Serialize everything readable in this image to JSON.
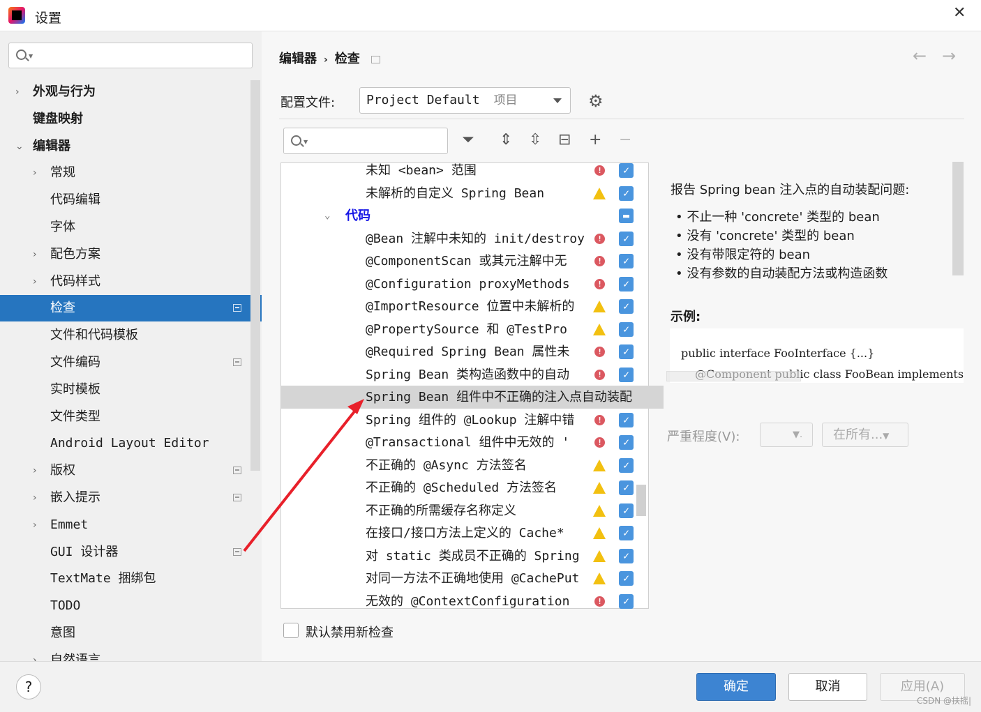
{
  "window": {
    "title": "设置",
    "close": "✕"
  },
  "sidebar": {
    "items": [
      {
        "label": "外观与行为",
        "level": 0,
        "chevron": "right"
      },
      {
        "label": "键盘映射",
        "level": 0,
        "chevron": ""
      },
      {
        "label": "编辑器",
        "level": 0,
        "chevron": "down"
      },
      {
        "label": "常规",
        "level": 1,
        "chevron": "right"
      },
      {
        "label": "代码编辑",
        "level": 1,
        "chevron": ""
      },
      {
        "label": "字体",
        "level": 1,
        "chevron": ""
      },
      {
        "label": "配色方案",
        "level": 1,
        "chevron": "right"
      },
      {
        "label": "代码样式",
        "level": 1,
        "chevron": "right"
      },
      {
        "label": "检查",
        "level": 1,
        "chevron": "",
        "selected": true,
        "project": true
      },
      {
        "label": "文件和代码模板",
        "level": 1,
        "chevron": ""
      },
      {
        "label": "文件编码",
        "level": 1,
        "chevron": "",
        "project": true
      },
      {
        "label": "实时模板",
        "level": 1,
        "chevron": ""
      },
      {
        "label": "文件类型",
        "level": 1,
        "chevron": ""
      },
      {
        "label": "Android Layout Editor",
        "level": 1,
        "chevron": ""
      },
      {
        "label": "版权",
        "level": 1,
        "chevron": "right",
        "project": true
      },
      {
        "label": "嵌入提示",
        "level": 1,
        "chevron": "right",
        "project": true
      },
      {
        "label": "Emmet",
        "level": 1,
        "chevron": "right"
      },
      {
        "label": "GUI 设计器",
        "level": 1,
        "chevron": "",
        "project": true
      },
      {
        "label": "TextMate 捆绑包",
        "level": 1,
        "chevron": ""
      },
      {
        "label": "TODO",
        "level": 1,
        "chevron": ""
      },
      {
        "label": "意图",
        "level": 1,
        "chevron": ""
      },
      {
        "label": "自然语言",
        "level": 1,
        "chevron": "right"
      }
    ]
  },
  "header": {
    "breadcrumb": [
      "编辑器",
      "›",
      "检查"
    ],
    "back": "←",
    "forward": "→"
  },
  "profile": {
    "label": "配置文件:",
    "value": "Project Default",
    "scope": "项目"
  },
  "toolbar": {
    "filter": "⏷",
    "expand": "⇕",
    "collapse": "⇳",
    "reset": "⊟",
    "add": "+",
    "remove": "−"
  },
  "inspections": [
    {
      "text": "未知 <bean> 范围",
      "severity": "error",
      "checked": true
    },
    {
      "text": "未解析的自定义 Spring Bean",
      "severity": "warning",
      "checked": true
    },
    {
      "text": "代码",
      "group": true,
      "checked": "partial"
    },
    {
      "text": "@Bean 注解中未知的 init/destroy",
      "severity": "error",
      "checked": true
    },
    {
      "text": "@ComponentScan 或其元注解中无",
      "severity": "error",
      "checked": true
    },
    {
      "text": "@Configuration proxyMethods",
      "severity": "error",
      "checked": true
    },
    {
      "text": "@ImportResource 位置中未解析的",
      "severity": "warning",
      "checked": true
    },
    {
      "text": "@PropertySource 和 @TestPro",
      "severity": "warning",
      "checked": true
    },
    {
      "text": "@Required Spring Bean 属性未",
      "severity": "error",
      "checked": true
    },
    {
      "text": "Spring Bean 类构造函数中的自动",
      "severity": "error",
      "checked": true
    },
    {
      "text": "Spring Bean 组件中不正确的注入点自动装配",
      "selected": true
    },
    {
      "text": "Spring 组件的 @Lookup 注解中错",
      "severity": "error",
      "checked": true
    },
    {
      "text": "@Transactional 组件中无效的 '",
      "severity": "error",
      "checked": true
    },
    {
      "text": "不正确的 @Async 方法签名",
      "severity": "warning",
      "checked": true
    },
    {
      "text": "不正确的 @Scheduled 方法签名",
      "severity": "warning",
      "checked": true
    },
    {
      "text": "不正确的所需缓存名称定义",
      "severity": "warning",
      "checked": true
    },
    {
      "text": "在接口/接口方法上定义的 Cache*",
      "severity": "warning",
      "checked": true
    },
    {
      "text": "对 static 类成员不正确的 Spring",
      "severity": "warning",
      "checked": true
    },
    {
      "text": "对同一方法不正确地使用 @CachePut",
      "severity": "warning",
      "checked": true
    },
    {
      "text": "无效的 @ContextConfiguration",
      "severity": "error",
      "checked": true
    }
  ],
  "description": {
    "intro": "报告 Spring bean 注入点的自动装配问题:",
    "bullets": [
      "不止一种 'concrete' 类型的 bean",
      "没有 'concrete' 类型的 bean",
      "没有带限定符的 bean",
      "没有参数的自动装配方法或构造函数"
    ],
    "example_label": "示例:",
    "code": [
      "public interface FooInterface {...}",
      "@Component public class FooBean implements"
    ]
  },
  "severity": {
    "label": "严重程度(V):",
    "value": "",
    "scope": "在所有..."
  },
  "options": {
    "disable_new": "默认禁用新检查",
    "disable_new_checked": false
  },
  "footer": {
    "help": "?",
    "ok": "确定",
    "cancel": "取消",
    "apply": "应用(A)"
  },
  "watermark": "CSDN @扶摇|",
  "colors": {
    "selection": "#2675bf",
    "primary_button": "#3d84d2",
    "checkbox": "#4a95de",
    "error": "#db5860",
    "warning": "#f2c010",
    "annotation_arrow": "#e8202a"
  }
}
